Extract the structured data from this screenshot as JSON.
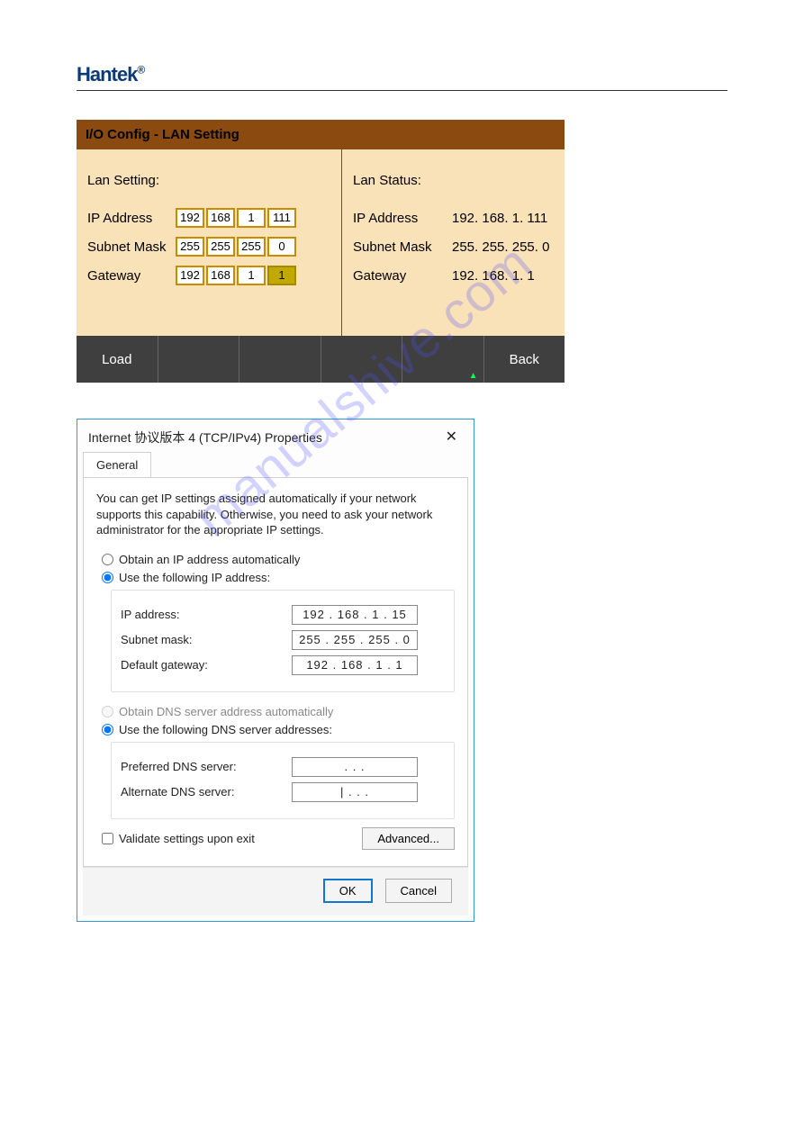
{
  "brand": "Hantek",
  "brand_reg": "®",
  "watermark": "manualshive.com",
  "lan_panel": {
    "title": "I/O Config - LAN Setting",
    "setting_head": "Lan Setting:",
    "status_head": "Lan Status:",
    "rows": {
      "ip": {
        "label": "IP Address",
        "octets": [
          "192",
          "168",
          "1",
          "111"
        ],
        "status": "192. 168. 1. 111"
      },
      "subnet": {
        "label": "Subnet Mask",
        "octets": [
          "255",
          "255",
          "255",
          "0"
        ],
        "status": "255. 255. 255. 0"
      },
      "gateway": {
        "label": "Gateway",
        "octets": [
          "192",
          "168",
          "1",
          "1"
        ],
        "status": "192. 168. 1. 1"
      }
    },
    "footer": {
      "load": "Load",
      "back": "Back"
    }
  },
  "win": {
    "title": "Internet 协议版本 4 (TCP/IPv4) Properties",
    "tab": "General",
    "intro": "You can get IP settings assigned automatically if your network supports this capability. Otherwise, you need to ask your network administrator for the appropriate IP settings.",
    "radio_auto_ip": "Obtain an IP address automatically",
    "radio_use_ip": "Use the following IP address:",
    "ip_label": "IP address:",
    "ip_value": "192 . 168 .  1  . 15",
    "subnet_label": "Subnet mask:",
    "subnet_value": "255 . 255 . 255 .  0",
    "gateway_label": "Default gateway:",
    "gateway_value": "192 . 168 .  1  .  1",
    "radio_auto_dns": "Obtain DNS server address automatically",
    "radio_use_dns": "Use the following DNS server addresses:",
    "pref_dns_label": "Preferred DNS server:",
    "pref_dns_value": ".       .       .",
    "alt_dns_label": "Alternate DNS server:",
    "alt_dns_value": "|      .       .       .",
    "validate_label": "Validate settings upon exit",
    "advanced": "Advanced...",
    "ok": "OK",
    "cancel": "Cancel"
  }
}
